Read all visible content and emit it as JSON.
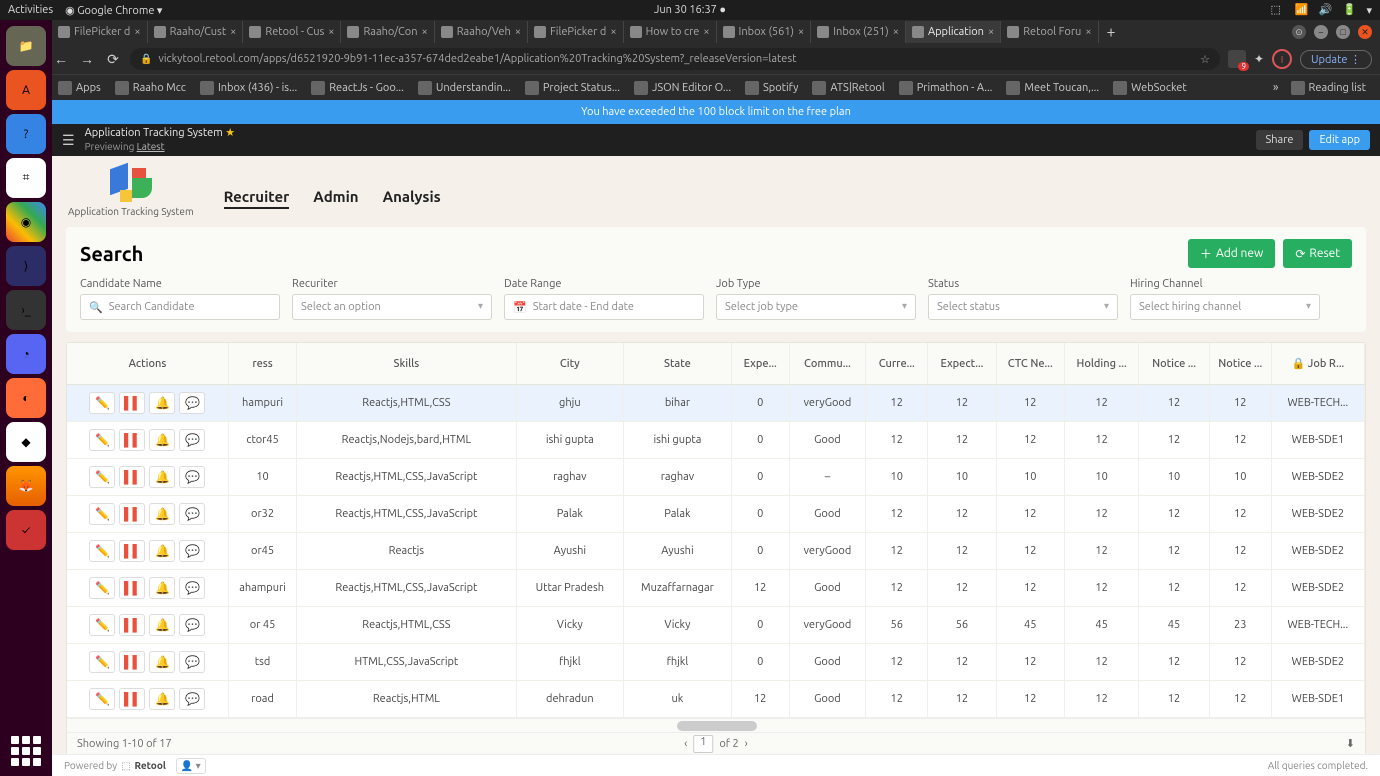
{
  "system": {
    "activities": "Activities",
    "app": "Google Chrome",
    "datetime": "Jun 30  16:37"
  },
  "tabs": [
    "FilePicker d",
    "Raaho/Cust",
    "Retool - Cus",
    "Raaho/Con",
    "Raaho/Veh",
    "FilePicker d",
    "How to cre",
    "Inbox (561)",
    "Inbox (251)",
    "Application",
    "Retool Foru"
  ],
  "active_tab": 9,
  "url": "vickytool.retool.com/apps/d6521920-9b91-11ec-a357-674ded2eabe1/Application%20Tracking%20System?_releaseVersion=latest",
  "update_label": "Update",
  "ext_badge": "9",
  "avatar_letter": "I",
  "bookmarks": [
    "Apps",
    "Raaho Mcc",
    "Inbox (436) - is...",
    "ReactJs - Goo...",
    "Understandin...",
    "Project Status...",
    "JSON Editor O...",
    "Spotify",
    "ATS|Retool",
    "Primathon - A...",
    "Meet Toucan,...",
    "WebSocket"
  ],
  "reading_list": "Reading list",
  "banner": "You have exceeded the 100 block limit on the free plan",
  "retool": {
    "title": "Application Tracking System",
    "preview": "Previewing",
    "latest": "Latest",
    "share": "Share",
    "edit": "Edit app"
  },
  "logo_text": "Application Tracking System",
  "nav": {
    "recruiter": "Recruiter",
    "admin": "Admin",
    "analysis": "Analysis"
  },
  "search": {
    "heading": "Search",
    "add": "Add new",
    "reset": "Reset",
    "f_name_label": "Candidate Name",
    "f_name_ph": "Search Candidate",
    "f_rec_label": "Recuriter",
    "f_rec_ph": "Select an option",
    "f_date_label": "Date Range",
    "f_date_ph": "Start date   -   End date",
    "f_job_label": "Job Type",
    "f_job_ph": "Select job type",
    "f_status_label": "Status",
    "f_status_ph": "Select status",
    "f_hire_label": "Hiring Channel",
    "f_hire_ph": "Select hiring channel"
  },
  "cols": [
    "Actions",
    "ress",
    "Skills",
    "City",
    "State",
    "Expe...",
    "Commu...",
    "Curre...",
    "Expect...",
    "CTC Ne...",
    "Holding ...",
    "Notice ...",
    "Notice ...",
    "🔒 Job R..."
  ],
  "rows": [
    {
      "addr": "hampuri",
      "skills": "Reactjs,HTML,CSS",
      "city": "ghju",
      "state": "bihar",
      "exp": "0",
      "comm": "veryGood",
      "c1": "12",
      "c2": "12",
      "c3": "12",
      "c4": "12",
      "c5": "12",
      "c6": "12",
      "job": "WEB-TECH..."
    },
    {
      "addr": "ctor45",
      "skills": "Reactjs,Nodejs,bard,HTML",
      "city": "ishi gupta",
      "state": "ishi gupta",
      "exp": "0",
      "comm": "Good",
      "c1": "12",
      "c2": "12",
      "c3": "12",
      "c4": "12",
      "c5": "12",
      "c6": "12",
      "job": "WEB-SDE1"
    },
    {
      "addr": "10",
      "skills": "Reactjs,HTML,CSS,JavaScript",
      "city": "raghav",
      "state": "raghav",
      "exp": "0",
      "comm": "–",
      "c1": "10",
      "c2": "10",
      "c3": "10",
      "c4": "10",
      "c5": "10",
      "c6": "10",
      "job": "WEB-SDE2"
    },
    {
      "addr": "or32",
      "skills": "Reactjs,HTML,CSS,JavaScript",
      "city": "Palak",
      "state": "Palak",
      "exp": "0",
      "comm": "Good",
      "c1": "12",
      "c2": "12",
      "c3": "12",
      "c4": "12",
      "c5": "12",
      "c6": "12",
      "job": "WEB-SDE2"
    },
    {
      "addr": "or45",
      "skills": "Reactjs",
      "city": "Ayushi",
      "state": "Ayushi",
      "exp": "0",
      "comm": "veryGood",
      "c1": "12",
      "c2": "12",
      "c3": "12",
      "c4": "12",
      "c5": "12",
      "c6": "12",
      "job": "WEB-SDE2"
    },
    {
      "addr": "ahampuri",
      "skills": "Reactjs,HTML,CSS,JavaScript",
      "city": "Uttar Pradesh",
      "state": "Muzaffarnagar",
      "exp": "12",
      "comm": "Good",
      "c1": "12",
      "c2": "12",
      "c3": "12",
      "c4": "12",
      "c5": "12",
      "c6": "12",
      "job": "WEB-SDE2"
    },
    {
      "addr": "or 45",
      "skills": "Reactjs,HTML,CSS",
      "city": "Vicky",
      "state": "Vicky",
      "exp": "0",
      "comm": "veryGood",
      "c1": "56",
      "c2": "56",
      "c3": "45",
      "c4": "45",
      "c5": "45",
      "c6": "23",
      "job": "WEB-TECH..."
    },
    {
      "addr": "tsd",
      "skills": "HTML,CSS,JavaScript",
      "city": "fhjkl",
      "state": "fhjkl",
      "exp": "0",
      "comm": "Good",
      "c1": "12",
      "c2": "12",
      "c3": "12",
      "c4": "12",
      "c5": "12",
      "c6": "12",
      "job": "WEB-SDE2"
    },
    {
      "addr": "road",
      "skills": "Reactjs,HTML",
      "city": "dehradun",
      "state": "uk",
      "exp": "12",
      "comm": "Good",
      "c1": "12",
      "c2": "12",
      "c3": "12",
      "c4": "12",
      "c5": "12",
      "c6": "12",
      "job": "WEB-SDE1"
    }
  ],
  "pager": {
    "showing": "Showing 1-10 of 17",
    "page": "1",
    "of": "of 2"
  },
  "footer": {
    "powered": "Powered by",
    "retool": "Retool",
    "queries": "All queries completed."
  }
}
